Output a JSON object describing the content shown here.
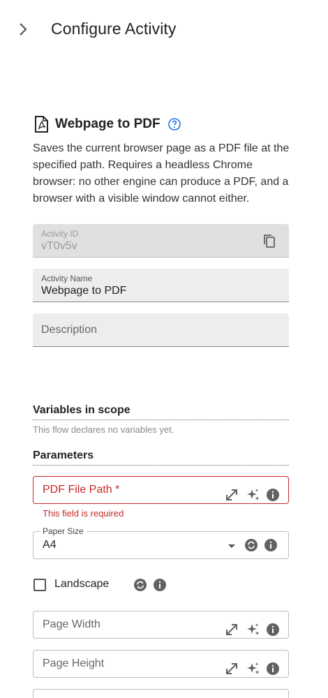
{
  "header": {
    "title": "Configure Activity"
  },
  "activity": {
    "title": "Webpage to PDF",
    "description": "Saves the current browser page as a PDF file at the specified path. Requires a headless Chrome browser: no other engine can produce a PDF, and a browser with a visible window cannot either."
  },
  "fields": {
    "activity_id": {
      "label": "Activity ID",
      "value": "vT0v5v"
    },
    "activity_name": {
      "label": "Activity Name",
      "value": "Webpage to PDF"
    },
    "description": {
      "placeholder": "Description"
    }
  },
  "variables": {
    "title": "Variables in scope",
    "note": "This flow declares no variables yet."
  },
  "parameters": {
    "title": "Parameters",
    "pdf_file_path": {
      "placeholder": "PDF File Path *",
      "error": "This field is required"
    },
    "paper_size": {
      "label": "Paper Size",
      "value": "A4"
    },
    "landscape": {
      "label": "Landscape",
      "checked": false
    },
    "page_width": {
      "placeholder": "Page Width"
    },
    "page_height": {
      "placeholder": "Page Height"
    }
  },
  "colors": {
    "error": "#c62828",
    "help_blue": "#1a73e8",
    "icon_gray": "#616161"
  }
}
